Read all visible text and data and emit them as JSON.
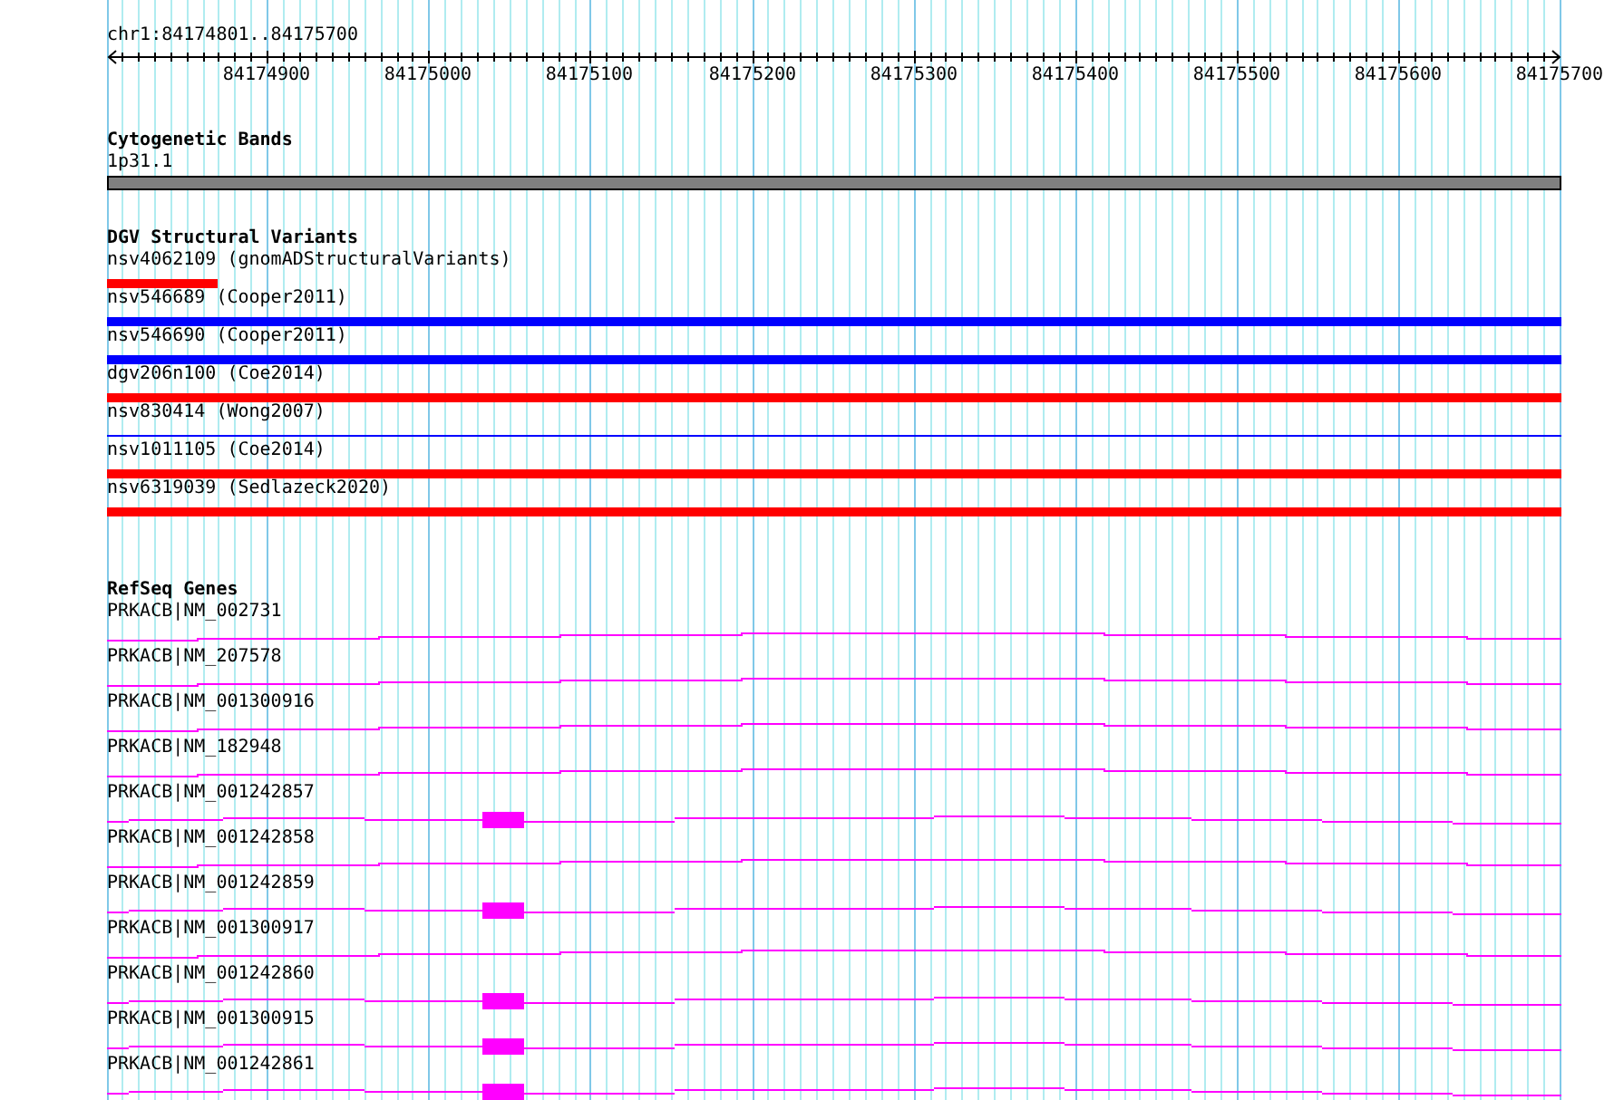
{
  "ruler": {
    "range": "chr1:84174801..84175700",
    "ticks": [
      "84174900",
      "84175000",
      "84175100",
      "84175200",
      "84175300",
      "84175400",
      "84175500",
      "84175600",
      "84175700"
    ]
  },
  "tracks": [
    {
      "kind": "bands",
      "title": "Cytogenetic Bands",
      "features": [
        {
          "label": "1p31.1",
          "kind": "band",
          "color": "#808080"
        }
      ]
    },
    {
      "kind": "variants",
      "title": "DGV Structural Variants",
      "features": [
        {
          "label": "nsv4062109 (gnomADStructuralVariants)",
          "kind": "short",
          "color": "#ff0000"
        },
        {
          "label": "nsv546689 (Cooper2011)",
          "kind": "bar",
          "color": "#0000ff"
        },
        {
          "label": "nsv546690 (Cooper2011)",
          "kind": "bar",
          "color": "#0000ff"
        },
        {
          "label": "dgv206n100 (Coe2014)",
          "kind": "bar",
          "color": "#ff0000"
        },
        {
          "label": "nsv830414 (Wong2007)",
          "kind": "line",
          "color": "#0000ff"
        },
        {
          "label": "nsv1011105 (Coe2014)",
          "kind": "bar",
          "color": "#ff0000"
        },
        {
          "label": "nsv6319039 (Sedlazeck2020)",
          "kind": "bar",
          "color": "#ff0000"
        }
      ]
    },
    {
      "kind": "genes",
      "title": "RefSeq Genes",
      "features": [
        {
          "label": "PRKACB|NM_002731",
          "kind": "intron"
        },
        {
          "label": "PRKACB|NM_207578",
          "kind": "intron"
        },
        {
          "label": "PRKACB|NM_001300916",
          "kind": "intron"
        },
        {
          "label": "PRKACB|NM_182948",
          "kind": "intron"
        },
        {
          "label": "PRKACB|NM_001242857",
          "kind": "exon"
        },
        {
          "label": "PRKACB|NM_001242858",
          "kind": "intron"
        },
        {
          "label": "PRKACB|NM_001242859",
          "kind": "exon"
        },
        {
          "label": "PRKACB|NM_001300917",
          "kind": "intron"
        },
        {
          "label": "PRKACB|NM_001242860",
          "kind": "exon"
        },
        {
          "label": "PRKACB|NM_001300915",
          "kind": "exon"
        },
        {
          "label": "PRKACB|NM_001242861",
          "kind": "exon"
        }
      ]
    }
  ]
}
